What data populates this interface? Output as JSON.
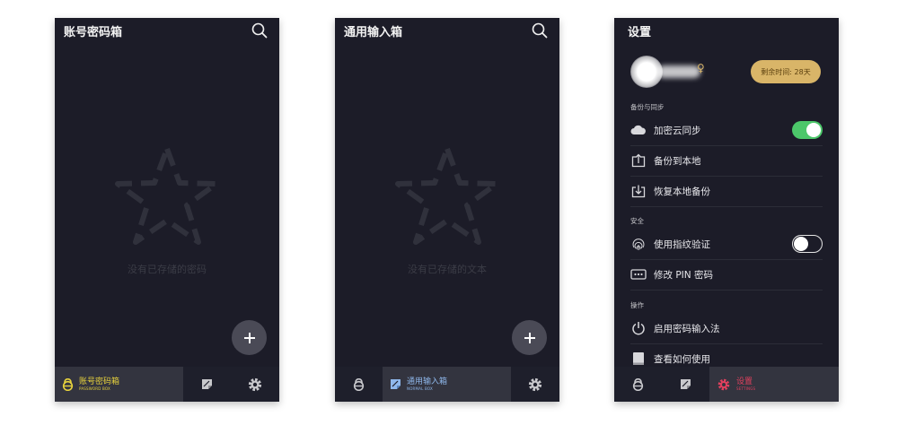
{
  "password_box": {
    "title": "账号密码箱",
    "empty_text": "没有已存储的密码",
    "tabs": {
      "active_label": "账号密码箱",
      "active_sub": "PASSWORD BOX"
    }
  },
  "normal_box": {
    "title": "通用输入箱",
    "empty_text": "没有已存储的文本",
    "tabs": {
      "active_label": "通用输入箱",
      "active_sub": "NORMAL BOX"
    }
  },
  "settings": {
    "title": "设置",
    "remaining": "剩余时间: 28天",
    "sections": {
      "backup": "备份与同步",
      "security": "安全",
      "operations": "操作"
    },
    "items": {
      "cloud_sync": "加密云同步",
      "backup_local": "备份到本地",
      "restore_local": "恢复本地备份",
      "fingerprint": "使用指纹验证",
      "change_pin": "修改 PIN 密码",
      "enable_ime": "启用密码输入法",
      "how_to_use": "查看如何使用"
    },
    "toggles": {
      "cloud_sync": true,
      "fingerprint": false
    },
    "tabs": {
      "active_label": "设置",
      "active_sub": "SETTINGS"
    }
  },
  "colors": {
    "background": "#1c1c28",
    "password_accent": "#e8d33d",
    "normal_accent": "#8fb8ec",
    "settings_accent": "#e0405e",
    "toggle_on": "#4cc76a",
    "remaining_badge": "#d9b568"
  }
}
